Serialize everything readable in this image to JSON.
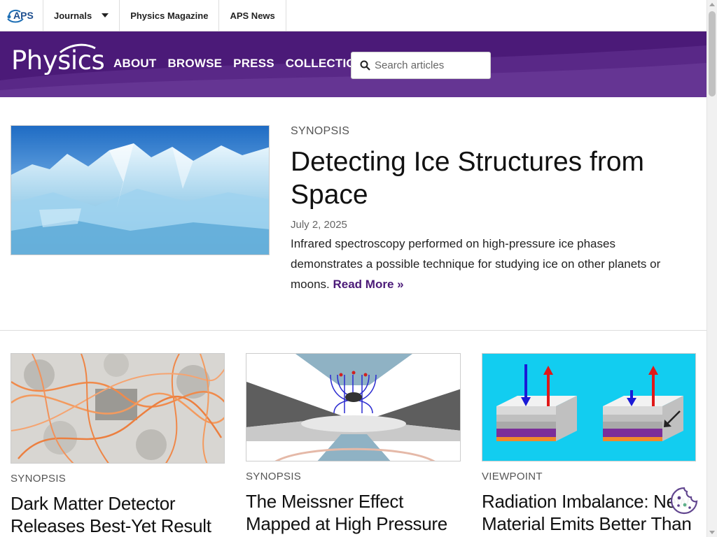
{
  "topbar": {
    "logo_text": "APS",
    "nav": [
      {
        "label": "Journals"
      },
      {
        "label": "Physics Magazine"
      },
      {
        "label": "APS News"
      }
    ]
  },
  "header": {
    "brand": "Physics",
    "nav": [
      {
        "label": "ABOUT"
      },
      {
        "label": "BROWSE"
      },
      {
        "label": "PRESS"
      },
      {
        "label": "COLLECTIONS"
      }
    ],
    "search_placeholder": "Search articles"
  },
  "featured": {
    "type": "SYNOPSIS",
    "title": "Detecting Ice Structures from Space",
    "date": "July 2, 2025",
    "description": "Infrared spectroscopy performed on high-pressure ice phases demonstrates a possible technique for studying ice on other planets or moons.",
    "read_more": "Read More »"
  },
  "cards": [
    {
      "type": "SYNOPSIS",
      "title": "Dark Matter Detector Releases Best-Yet Result"
    },
    {
      "type": "SYNOPSIS",
      "title": "The Meissner Effect Mapped at High Pressure"
    },
    {
      "type": "VIEWPOINT",
      "title": "Radiation Imbalance: New Material Emits Better Than"
    }
  ],
  "colors": {
    "brand_purple": "#4b1a78",
    "read_more": "#4b1a78"
  }
}
